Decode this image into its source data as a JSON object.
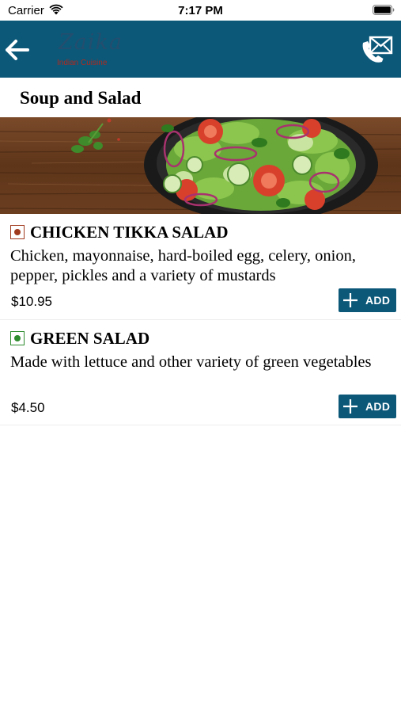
{
  "colors": {
    "nav_background": "#0b5879",
    "veg_indicator": "#2e8b2e",
    "nonveg_indicator": "#a03a1e",
    "add_button": "#0b5879"
  },
  "status_bar": {
    "carrier": "Carrier",
    "time": "7:17 PM",
    "icons": [
      "wifi-icon",
      "battery-icon"
    ]
  },
  "nav": {
    "back_icon": "back-arrow-icon",
    "logo_text": "Zaika",
    "logo_subtitle": "Indian Cuisine",
    "contact_icon": "mail-phone-icon"
  },
  "page": {
    "title": "Soup and Salad"
  },
  "items": [
    {
      "name": "CHICKEN TIKKA SALAD",
      "description": "Chicken, mayonnaise, hard-boiled egg, celery, onion, pepper, pickles and a variety of mustards",
      "price": "$10.95",
      "type": "non-veg",
      "add_label": "ADD"
    },
    {
      "name": "GREEN SALAD",
      "description": "Made with lettuce and other variety of green vegetables",
      "price": "$4.50",
      "type": "veg",
      "add_label": "ADD"
    }
  ]
}
